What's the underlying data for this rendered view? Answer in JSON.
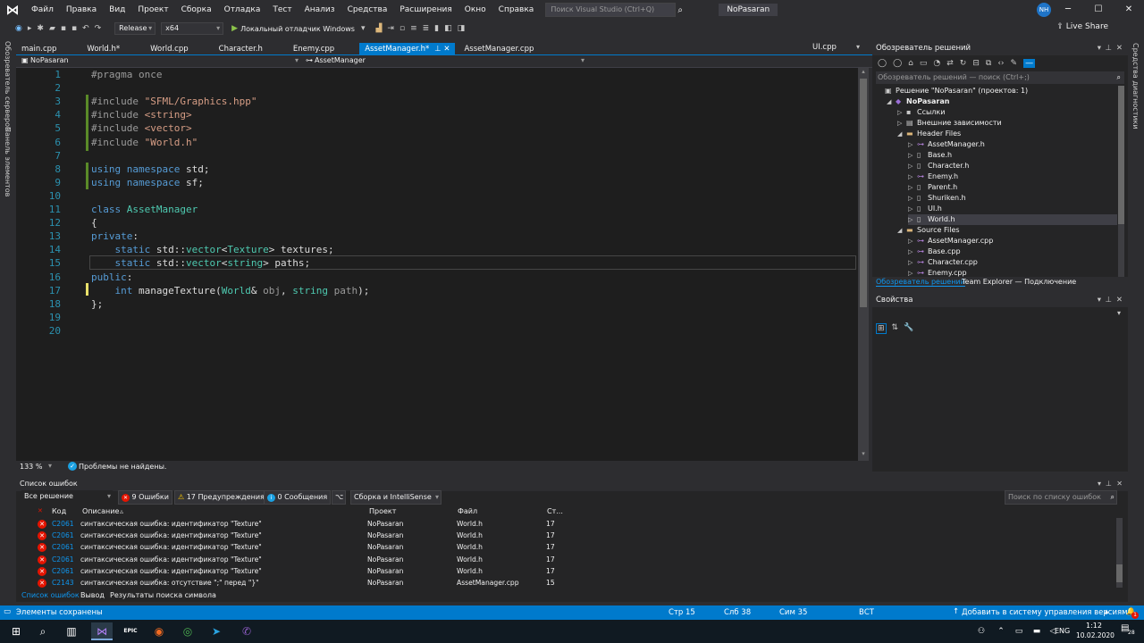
{
  "title_bar": {
    "menu": [
      "Файл",
      "Правка",
      "Вид",
      "Проект",
      "Сборка",
      "Отладка",
      "Тест",
      "Анализ",
      "Средства",
      "Расширения",
      "Окно",
      "Справка"
    ],
    "search_placeholder": "Поиск Visual Studio (Ctrl+Q)",
    "solution_name": "NoPasaran",
    "user_initials": "NH",
    "minimize": "─",
    "maximize": "☐",
    "close": "✕"
  },
  "toolbar": {
    "configuration": "Release",
    "platform": "x64",
    "debugger": "Локальный отладчик Windows",
    "live_share": "Live Share"
  },
  "side_strips": {
    "left_top": "Обозреватель серверов",
    "left_bottom": "Панель элементов",
    "right": "Средства диагностики"
  },
  "tabs": [
    {
      "label": "main.cpp",
      "active": false
    },
    {
      "label": "World.h*",
      "active": false
    },
    {
      "label": "World.cpp",
      "active": false
    },
    {
      "label": "Character.h",
      "active": false
    },
    {
      "label": "Enemy.cpp",
      "active": false
    },
    {
      "label": "AssetManager.h*",
      "active": true
    },
    {
      "label": "AssetManager.cpp",
      "active": false
    }
  ],
  "tab_right": "UI.cpp",
  "nav_bar": {
    "project": "NoPasaran",
    "scope": "AssetManager"
  },
  "code_lines": [
    {
      "n": "1",
      "html": "<span class='pp'>#pragma once</span>"
    },
    {
      "n": "2",
      "html": ""
    },
    {
      "n": "3",
      "html": "<span class='pp'>#include </span><span class='str'>\"SFML/Graphics.hpp\"</span>"
    },
    {
      "n": "4",
      "html": "<span class='pp'>#include </span><span class='str'>&lt;string&gt;</span>"
    },
    {
      "n": "5",
      "html": "<span class='pp'>#include </span><span class='str'>&lt;vector&gt;</span>"
    },
    {
      "n": "6",
      "html": "<span class='pp'>#include </span><span class='str'>\"World.h\"</span>"
    },
    {
      "n": "7",
      "html": ""
    },
    {
      "n": "8",
      "html": "<span class='kw'>using namespace</span> std;"
    },
    {
      "n": "9",
      "html": "<span class='kw'>using namespace</span> sf;"
    },
    {
      "n": "10",
      "html": ""
    },
    {
      "n": "11",
      "html": "<span class='kw'>class</span> <span class='typ'>AssetManager</span>"
    },
    {
      "n": "12",
      "html": "{"
    },
    {
      "n": "13",
      "html": "<span class='kw'>private</span>:"
    },
    {
      "n": "14",
      "html": "    <span class='kw'>static</span> std::<span class='typ'>vector</span>&lt;<span class='typ'>Texture</span>&gt; textures;"
    },
    {
      "n": "15",
      "html": "    <span class='kw'>static</span> std::<span class='typ'>vector</span>&lt;<span class='typ'>string</span>&gt; paths;"
    },
    {
      "n": "16",
      "html": "<span class='kw'>public</span>:"
    },
    {
      "n": "17",
      "html": "    <span class='kw'>int</span> manageTexture(<span class='typ'>World</span>&amp; <span class='prm'>obj</span>, <span class='typ'>string</span> <span class='prm'>path</span>);"
    },
    {
      "n": "18",
      "html": "};"
    },
    {
      "n": "19",
      "html": ""
    },
    {
      "n": "20",
      "html": ""
    }
  ],
  "editor_status": {
    "zoom": "133 %",
    "message": "Проблемы не найдены."
  },
  "solution_explorer": {
    "title": "Обозреватель решений",
    "search_placeholder": "Обозреватель решений — поиск (Ctrl+;)",
    "nodes": [
      {
        "label": "Решение \"NoPasaran\"  (проектов: 1)",
        "indent": 0,
        "arrow": "",
        "icon": "▣",
        "bold": false,
        "selected": false
      },
      {
        "label": "NoPasaran",
        "indent": 1,
        "arrow": "◢",
        "icon": "◆",
        "bold": true,
        "selected": false
      },
      {
        "label": "Ссылки",
        "indent": 2,
        "arrow": "▷",
        "icon": "▪",
        "bold": false,
        "selected": false
      },
      {
        "label": "Внешние зависимости",
        "indent": 2,
        "arrow": "▷",
        "icon": "▤",
        "bold": false,
        "selected": false
      },
      {
        "label": "Header Files",
        "indent": 2,
        "arrow": "◢",
        "icon": "▬",
        "bold": false,
        "selected": false
      },
      {
        "label": "AssetManager.h",
        "indent": 3,
        "arrow": "▷",
        "icon": "⊶",
        "bold": false,
        "selected": false
      },
      {
        "label": "Base.h",
        "indent": 3,
        "arrow": "▷",
        "icon": "▯",
        "bold": false,
        "selected": false
      },
      {
        "label": "Character.h",
        "indent": 3,
        "arrow": "▷",
        "icon": "▯",
        "bold": false,
        "selected": false
      },
      {
        "label": "Enemy.h",
        "indent": 3,
        "arrow": "▷",
        "icon": "⊶",
        "bold": false,
        "selected": false
      },
      {
        "label": "Parent.h",
        "indent": 3,
        "arrow": "▷",
        "icon": "▯",
        "bold": false,
        "selected": false
      },
      {
        "label": "Shuriken.h",
        "indent": 3,
        "arrow": "▷",
        "icon": "▯",
        "bold": false,
        "selected": false
      },
      {
        "label": "UI.h",
        "indent": 3,
        "arrow": "▷",
        "icon": "▯",
        "bold": false,
        "selected": false
      },
      {
        "label": "World.h",
        "indent": 3,
        "arrow": "▷",
        "icon": "▯",
        "bold": false,
        "selected": true
      },
      {
        "label": "Source Files",
        "indent": 2,
        "arrow": "◢",
        "icon": "▬",
        "bold": false,
        "selected": false
      },
      {
        "label": "AssetManager.cpp",
        "indent": 3,
        "arrow": "▷",
        "icon": "⊶",
        "bold": false,
        "selected": false
      },
      {
        "label": "Base.cpp",
        "indent": 3,
        "arrow": "▷",
        "icon": "⊶",
        "bold": false,
        "selected": false
      },
      {
        "label": "Character.cpp",
        "indent": 3,
        "arrow": "▷",
        "icon": "⊶",
        "bold": false,
        "selected": false
      },
      {
        "label": "Enemy.cpp",
        "indent": 3,
        "arrow": "▷",
        "icon": "⊶",
        "bold": false,
        "selected": false
      }
    ],
    "bottom_tabs": [
      "Обозреватель решений",
      "Team Explorer — Подключение"
    ]
  },
  "properties": {
    "title": "Свойства"
  },
  "error_list": {
    "title": "Список ошибок",
    "scope": "Все решение",
    "errors_btn": "9 Ошибки",
    "warnings_btn": "17 Предупреждения",
    "messages_btn": "0 Сообщения",
    "build_filter": "Сборка и IntelliSense",
    "search_placeholder": "Поиск по списку ошибок",
    "headers": {
      "code": "Код",
      "desc": "Описание",
      "project": "Проект",
      "file": "Файл",
      "line": "Ст..."
    },
    "rows": [
      {
        "code": "C2061",
        "desc": "синтаксическая ошибка: идентификатор \"Texture\"",
        "project": "NoPasaran",
        "file": "World.h",
        "line": "17"
      },
      {
        "code": "C2061",
        "desc": "синтаксическая ошибка: идентификатор \"Texture\"",
        "project": "NoPasaran",
        "file": "World.h",
        "line": "17"
      },
      {
        "code": "C2061",
        "desc": "синтаксическая ошибка: идентификатор \"Texture\"",
        "project": "NoPasaran",
        "file": "World.h",
        "line": "17"
      },
      {
        "code": "C2061",
        "desc": "синтаксическая ошибка: идентификатор \"Texture\"",
        "project": "NoPasaran",
        "file": "World.h",
        "line": "17"
      },
      {
        "code": "C2061",
        "desc": "синтаксическая ошибка: идентификатор \"Texture\"",
        "project": "NoPasaran",
        "file": "World.h",
        "line": "17"
      },
      {
        "code": "C2143",
        "desc": "синтаксическая ошибка: отсутствие \";\" перед \"}\"",
        "project": "NoPasaran",
        "file": "AssetManager.cpp",
        "line": "15"
      }
    ],
    "bottom_tabs": [
      "Список ошибок",
      "Вывод",
      "Результаты поиска символа"
    ]
  },
  "status_bar": {
    "message": "Элементы сохранены",
    "line": "Стр 15",
    "col": "Слб 38",
    "char": "Сим 35",
    "mode": "ВСТ",
    "vcs": "Добавить в систему управления версиями",
    "notif_count": "1"
  },
  "taskbar": {
    "lang": "ENG",
    "time": "1:12",
    "date": "10.02.2020",
    "notif": "28",
    "epic": "EPIC"
  },
  "colors": {
    "accent": "#007acc",
    "editor_bg": "#1e1e1e",
    "chrome": "#2d2d30",
    "error": "#e51400",
    "warning": "#ffcc00"
  }
}
